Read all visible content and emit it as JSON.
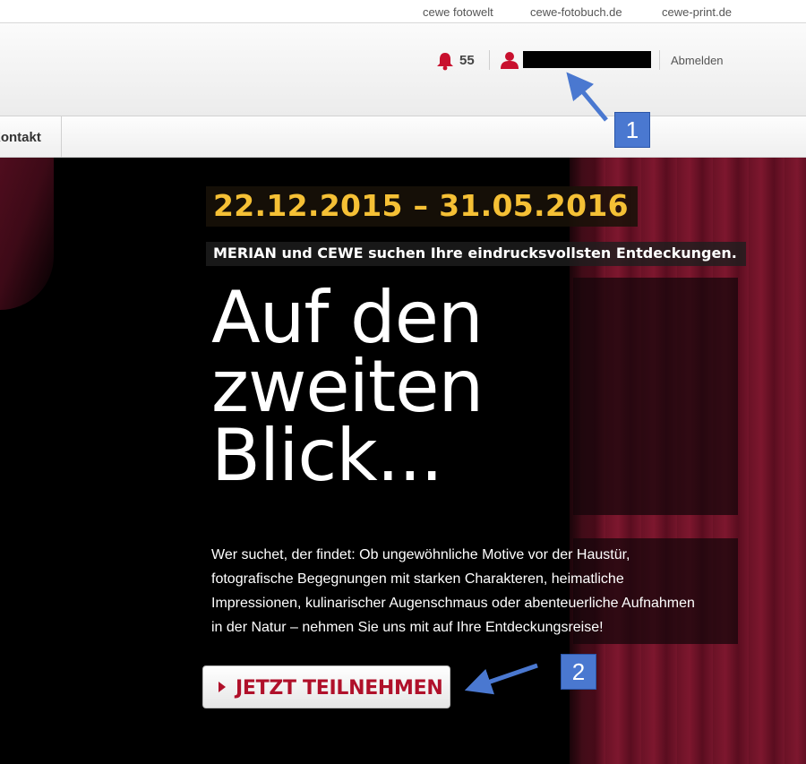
{
  "top_links": [
    "cewe fotowelt",
    "cewe-fotobuch.de",
    "cewe-print.de"
  ],
  "header": {
    "notification_count": "55",
    "user_name": "",
    "logout_label": "Abmelden"
  },
  "nav": {
    "items": [
      "Kontakt"
    ]
  },
  "hero": {
    "date_range": "22.12.2015 – 31.05.2016",
    "subtitle": "MERIAN und CEWE suchen Ihre eindrucksvollsten Entdeckungen.",
    "headline_lines": [
      "Auf den",
      "zweiten",
      "Blick..."
    ],
    "body_lines": [
      "Wer suchet, der findet: Ob ungewöhnliche Motive vor der Haustür,",
      "fotografische Begegnungen mit starken Charakteren, heimatliche",
      "Impressionen, kulinarischer Augenschmaus oder abenteuerliche Aufnahmen",
      "in der Natur – nehmen Sie uns mit auf Ihre Entdeckungsreise!"
    ],
    "cta_label": "JETZT TEILNEHMEN"
  },
  "annotations": [
    "1",
    "2"
  ],
  "colors": {
    "accent_red": "#b0102a",
    "date_yellow": "#f5c035",
    "annotation_blue": "#4a78d0"
  },
  "icons": [
    "bell-icon",
    "user-icon",
    "play-arrow-icon"
  ]
}
